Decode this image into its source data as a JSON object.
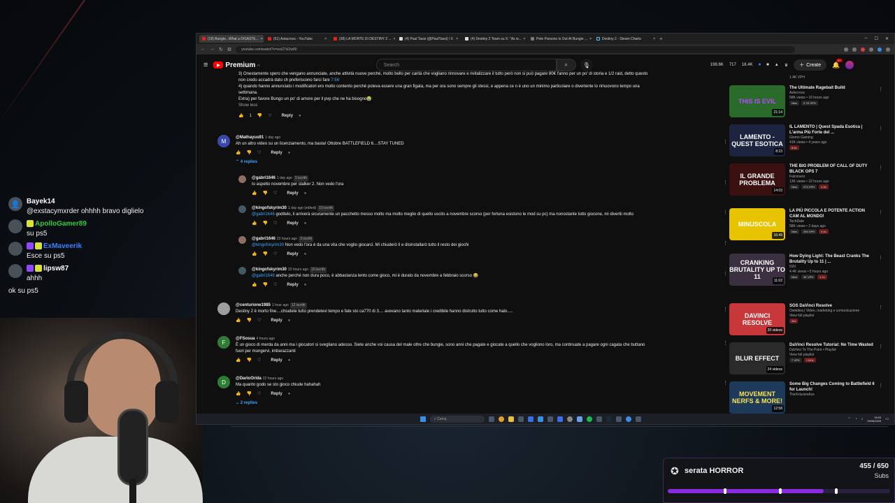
{
  "chat": [
    {
      "user": "Bayek14",
      "color": "#ffffff",
      "text": "@exstacymxrder ohhhh bravo diglielo",
      "avatar": "person-icon",
      "badges": 0
    },
    {
      "user": "ApolloGamer89",
      "color": "#2ecc40",
      "text": "su ps5",
      "avatar": "A",
      "badges": 1
    },
    {
      "user": "ExMaveerik",
      "color": "#3d7fff",
      "text": "Esce su ps5",
      "avatar": "E",
      "badges": 2
    },
    {
      "user": "lipsw87",
      "color": "#ffffff",
      "text": "ahhh",
      "avatar": "L",
      "badges": 2
    },
    {
      "user": "",
      "color": "#ffffff",
      "text": "ok su ps5",
      "avatar": "",
      "badges": 0
    }
  ],
  "browser": {
    "tabs": [
      "(19) Bungie...What a DISASTE...",
      "(61) Astacross - YouTube",
      "(38) LA MORTE DI DESTINY 2 ...",
      "(4) Paul Tassi (@PaulTassi) / X",
      "(4) Destiny 2 Team su X: \"As w...",
      "Pete Parsons Is Out At Bungie ...",
      "Destiny 2 - Steam Charts"
    ],
    "url": "youtube.com/watch?v=ooi27sI2w80"
  },
  "youtube": {
    "logo": "Premium",
    "logo_sup": "IT",
    "search_placeholder": "Search",
    "stats": [
      "198.6K",
      "717",
      "18.4K"
    ],
    "create_label": "Create",
    "notif_count": "9+"
  },
  "comments": {
    "top_lines": [
      "3) Onestamente spero che vengano annunciate, anche attività nuove perché, molto bello per carità che vogliano rinnovare e rivitalizzare il tutto però non si può pagare 80€ l'anno per un po' di storia e 1/2 raid, detto questo",
      "non credo accadrà dato ch preferiscono farci fare ",
      "4) quando hanno annunciato i modificatori ero molto contento perché poteva essere una gran figata, ma per ora sono sempre gli stessi, e appena ce n è uno un minimo particolare o divertente lo rimuovono tempo una",
      "settimana.",
      "Extra) per favore Bungo un po' di amore per il pvp che ne ha bisogno😭"
    ],
    "top_link": "7:56",
    "show_less": "Show less",
    "top_likes": "1",
    "reply_label": "Reply",
    "items": [
      {
        "author": "@Mathayus91",
        "time": "1 day ago",
        "tag": "",
        "text": "Ah un altro video su un licenziamento, ma basta! Ottobre BATTLEFIELD 6....STAY TUNED",
        "avatar": "M",
        "color": "#3949ab",
        "replies": "4 replies"
      },
      {
        "author": "@gabri1646",
        "time": "1 day ago",
        "tag": "3 iscritti",
        "mention": "",
        "text": "Io aspetto novembre per stalker 2. Non vedo l'ora",
        "color": "#8d6e63"
      },
      {
        "author": "@kingofskyrim30",
        "time": "1 day ago (edited)",
        "tag": "10 iscritti",
        "mention": "@gabri1646",
        "text": " goditelo, li arriverà sicuramente un pacchetto messo molto ma molto meglio di quello uscito a novembre scorso (per fortuna esistono le mod su pc) ma nonostante tutto giocone, mi divertii molto",
        "color": "#455a64"
      },
      {
        "author": "@gabri1646",
        "time": "23 hours ago",
        "tag": "3 iscritti",
        "mention": "@kingofskyrim30",
        "text": " Non vedo l'ora è da una vita che voglio giocarci. Mi chiuderò lì e disinstallarò tutto il resto dei giochi",
        "color": "#8d6e63"
      },
      {
        "author": "@kingofskyrim30",
        "time": "23 hours ago",
        "tag": "10 iscritti",
        "mention": "@gabri1646",
        "text": " anche perché non dura poco, è abbastanza lento come gioco, mi è durato da novembre a febbraio scorso 😂",
        "color": "#455a64"
      },
      {
        "author": "@centurione1985",
        "time": "1 hour ago",
        "tag": "12 iscritti",
        "text": "Destiny 2 è morto fine....chiudete tutto prendetevi tempo e fate sto ca770 di 3.... avevano tanto materiale i credibile hanno distrutto tutto come halo.....",
        "avatar": "",
        "color": "#9e9e9e"
      },
      {
        "author": "@FSosua",
        "time": "4 hours ago",
        "tag": "",
        "text": "È un gioco di merda da anni ma i giocatori si svegliano adesso. Siete anche voi causa del male oltre che bungie, sono anni che pagate e giocate a quello che vogliono loro, ma continuate a pagare ogni cagata che buttano",
        "text2": "fuori per mungervi, imbarazzanti",
        "avatar": "F",
        "color": "#2e7d32"
      },
      {
        "author": "@DarioOrlda",
        "time": "22 hours ago",
        "tag": "",
        "text": "Ma quanto godo se sto gioco chiude hahahah",
        "avatar": "D",
        "color": "#2e7d32",
        "replies": "2 replies"
      }
    ]
  },
  "sidebar": {
    "top_meta": "1.4K VPH",
    "items": [
      {
        "title": "The Ultimate Ragebait Build",
        "channel": "Aztecross",
        "meta": "58K views • 16 hours ago",
        "pills": [
          "New",
          "2.7K VPH"
        ],
        "thumb_text": "THIS IS EVIL",
        "duration": "21:14",
        "bg": "#2a6a2a",
        "fg": "#b64aff"
      },
      {
        "title": "IL LAMENTO | Quest Spada Esotica | L'arma Più Forte del ...",
        "channel": "Giomo Gaming",
        "meta": "41K views • 4 years ago",
        "pills": [
          "8.6x"
        ],
        "thumb_text": "LAMENTO - QUEST ESOTICA",
        "duration": "8:23",
        "bg": "#1c2440",
        "fg": "#ffffff"
      },
      {
        "title": "THE BIG PROBLEM OF CALL OF DUTY BLACK OPS 7",
        "channel": "Falconero",
        "meta": "13K views • 22 hours ago",
        "pills": [
          "New",
          "472 VPH",
          "1.3x"
        ],
        "thumb_text": "IL GRANDE PROBLEMA",
        "duration": "14:03",
        "bg": "#3a1010",
        "fg": "#ffffff"
      },
      {
        "title": "LA PIÙ PICCOLA E POTENTE ACTION CAM AL MONDO!",
        "channel": "TechDale",
        "meta": "58K views • 2 days ago",
        "pills": [
          "New",
          "294 VPH",
          "0.4x"
        ],
        "thumb_text": "MINUSCOLA",
        "duration": "16:49",
        "bg": "#e8c400",
        "fg": "#ffffff"
      },
      {
        "title": "How Dying Light: The Beast Cranks The Brutality Up to 11 | ...",
        "channel": "IGN",
        "meta": "4.4K views • 5 hours ago",
        "pills": [
          "New",
          "4K VPH",
          "1.1x"
        ],
        "thumb_text": "CRANKING BRUTALITY UP TO 11",
        "duration": "11:02",
        "bg": "#3a3040",
        "fg": "#ffffff"
      },
      {
        "title": "SOS DaVinci Resolve",
        "channel": "Ownidea | Video, marketing e comunicazione",
        "meta": "View full playlist",
        "pills": [
          "30x"
        ],
        "thumb_text": "DAVINCI RESOLVE",
        "duration": "20 videos",
        "bg": "#c8373a",
        "fg": "#ffffff"
      },
      {
        "title": "DaVinci Resolve Tutorial: No Time Wasted",
        "channel": "DaVinci To The Point • Playlist",
        "meta": "View full playlist",
        "pills": [
          "7 VPH",
          "+100x"
        ],
        "thumb_text": "BLUR EFFECT",
        "duration": "24 videos",
        "bg": "#2a2a2a",
        "fg": "#ffffff"
      },
      {
        "title": "Some Big Changes Coming to Battlefield 6 for Launch!",
        "channel": "TheXclusiveAce",
        "meta": "",
        "pills": [],
        "thumb_text": "MOVEMENT NERFS & MORE!",
        "duration": "12:58",
        "bg": "#1e3a5a",
        "fg": "#ffe54a"
      }
    ]
  },
  "taskbar": {
    "search": "Cerca",
    "time": "18:03",
    "date": "28/08/2025"
  },
  "goal": {
    "title": "serata HORROR",
    "count": "455 / 650",
    "label": "Subs",
    "progress": 0.7
  }
}
